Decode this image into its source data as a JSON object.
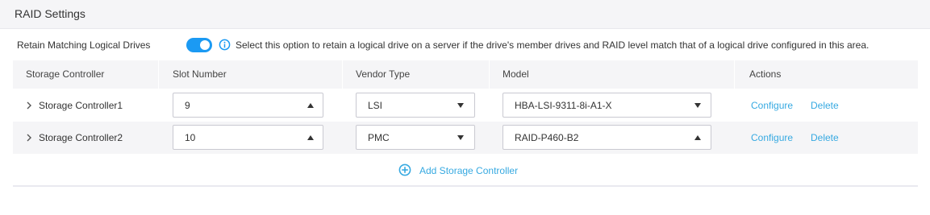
{
  "section": {
    "title": "RAID Settings"
  },
  "retain": {
    "label": "Retain Matching Logical Drives",
    "enabled": true,
    "description": "Select this option to retain a logical drive on a server if the drive's member drives and RAID level match that of a logical drive configured in this area."
  },
  "table": {
    "headers": {
      "controller": "Storage Controller",
      "slot": "Slot Number",
      "vendor": "Vendor Type",
      "model": "Model",
      "actions": "Actions"
    },
    "rows": [
      {
        "name": "Storage Controller1",
        "slot": "9",
        "vendor": "LSI",
        "model": "HBA-LSI-9311-8i-A1-X",
        "configure": "Configure",
        "delete": "Delete"
      },
      {
        "name": "Storage Controller2",
        "slot": "10",
        "vendor": "PMC",
        "model": "RAID-P460-B2",
        "configure": "Configure",
        "delete": "Delete"
      }
    ]
  },
  "add": {
    "label": "Add Storage Controller"
  },
  "colors": {
    "accent": "#1b9af3",
    "link": "#36a9e1",
    "header_bg": "#f5f5f7"
  }
}
